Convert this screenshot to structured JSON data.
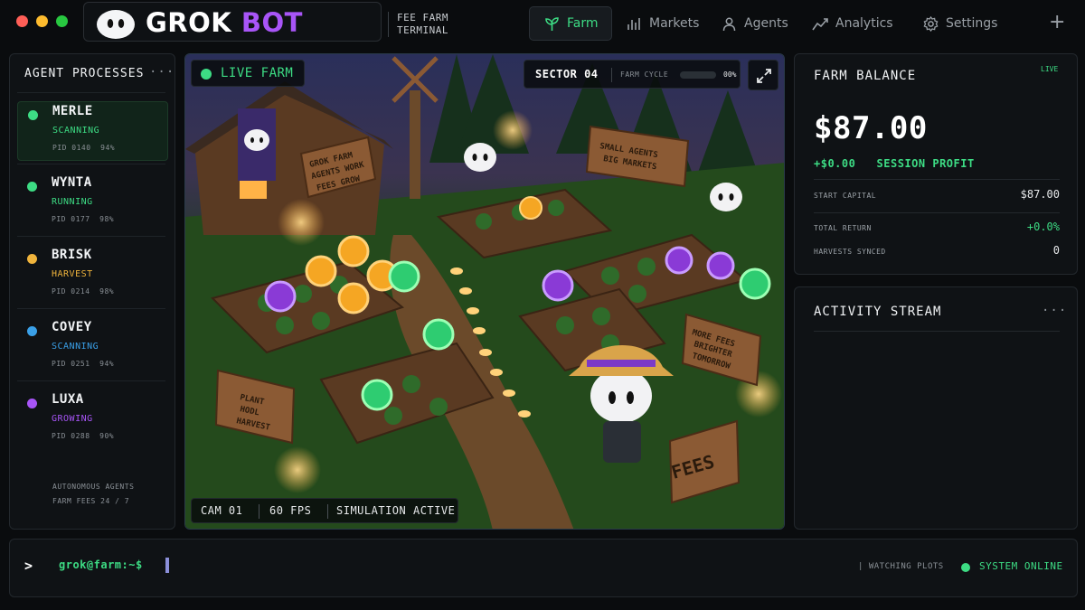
{
  "window": {
    "brand_word1": "GROK",
    "brand_word2": "BOT",
    "subtitle_line1": "FEE FARM",
    "subtitle_line2": "TERMINAL"
  },
  "nav": {
    "tabs": [
      {
        "label": "Farm",
        "icon": "sprout-icon",
        "active": true
      },
      {
        "label": "Markets",
        "icon": "bar-chart-icon",
        "active": false
      },
      {
        "label": "Agents",
        "icon": "user-icon",
        "active": false
      },
      {
        "label": "Analytics",
        "icon": "trend-line-icon",
        "active": false
      },
      {
        "label": "Settings",
        "icon": "gear-icon",
        "active": false
      }
    ],
    "add_label": "+"
  },
  "agents_panel": {
    "title": "AGENT PROCESSES",
    "menu": "···",
    "agents": [
      {
        "name": "MERLE",
        "status": "SCANNING",
        "pid": "PID 0140",
        "pct": "94%",
        "color": "#3ddc84",
        "status_color": "#3ddc84"
      },
      {
        "name": "WYNTA",
        "status": "RUNNING",
        "pid": "PID 0177",
        "pct": "98%",
        "color": "#3ddc84",
        "status_color": "#3ddc84"
      },
      {
        "name": "BRISK",
        "status": "HARVEST",
        "pid": "PID 0214",
        "pct": "98%",
        "color": "#f0b43c",
        "status_color": "#f0b43c"
      },
      {
        "name": "COVEY",
        "status": "SCANNING",
        "pid": "PID 0251",
        "pct": "94%",
        "color": "#3aa0e8",
        "status_color": "#3aa0e8"
      },
      {
        "name": "LUXA",
        "status": "GROWING",
        "pid": "PID 0288",
        "pct": "90%",
        "color": "#a855f7",
        "status_color": "#a855f7"
      }
    ],
    "footer_line1": "AUTONOMOUS AGENTS",
    "footer_line2": "FARM FEES 24 / 7"
  },
  "scene": {
    "live_label": "LIVE FARM",
    "sector": "SECTOR 04",
    "cycle_label": "FARM CYCLE",
    "cycle_value": "00%",
    "cycle_fraction": 0.0,
    "cam": "CAM 01",
    "fps": "60 FPS",
    "sim": "SIMULATION ACTIVE",
    "signs": {
      "barn_l1": "GROK FARM",
      "barn_l2": "AGENTS WORK",
      "barn_l3": "FEES GROW",
      "top_l1": "SMALL AGENTS",
      "top_l2": "BIG MARKETS",
      "left_l1": "PLANT",
      "left_l2": "HODL",
      "left_l3": "HARVEST",
      "right_l1": "MORE FEES",
      "right_l2": "BRIGHTER",
      "right_l3": "TOMORROW",
      "crate": "FEES"
    }
  },
  "balance_panel": {
    "title": "FARM BALANCE",
    "live": "LIVE",
    "amount": "$87.00",
    "profit_value": "+$0.00",
    "profit_label": "SESSION PROFIT",
    "rows": [
      {
        "label": "START CAPITAL",
        "value": "$87.00",
        "color": "#e6e8ea"
      },
      {
        "label": "TOTAL RETURN",
        "value": "+0.0%",
        "color": "#3ddc84"
      },
      {
        "label": "HARVESTS SYNCED",
        "value": "0",
        "color": "#e6e8ea"
      }
    ]
  },
  "activity_panel": {
    "title": "ACTIVITY STREAM",
    "menu": "···"
  },
  "terminal": {
    "caret": ">",
    "prompt": "grok@farm:~$",
    "watching": "| WATCHING PLOTS",
    "status": "SYSTEM ONLINE"
  }
}
